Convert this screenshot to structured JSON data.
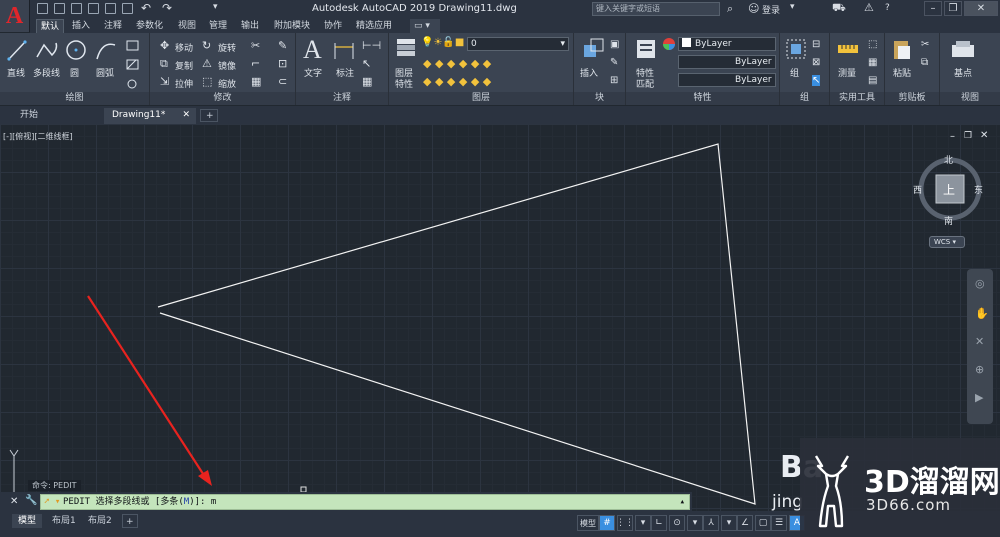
{
  "titlebar": {
    "logo_letter": "A",
    "title": "Autodesk AutoCAD 2019    Drawing11.dwg",
    "search_placeholder": "键入关键字或短语",
    "login": "登录",
    "help": "?"
  },
  "ribbon_tabs": [
    "默认",
    "插入",
    "注释",
    "参数化",
    "视图",
    "管理",
    "输出",
    "附加模块",
    "协作",
    "精选应用"
  ],
  "panels": {
    "draw": {
      "title": "绘图",
      "items": [
        "直线",
        "多段线",
        "圆",
        "圆弧"
      ]
    },
    "modify": {
      "title": "修改",
      "items": [
        "移动",
        "旋转",
        "复制",
        "镜像",
        "拉伸",
        "缩放"
      ]
    },
    "annotation": {
      "title": "注释",
      "items": [
        "文字",
        "标注"
      ]
    },
    "layers": {
      "title": "图层",
      "items": [
        "图层",
        "特性"
      ],
      "layer_value": "0"
    },
    "block": {
      "title": "块",
      "items": [
        "插入"
      ]
    },
    "properties": {
      "title": "特性",
      "items": [
        "特性",
        "匹配"
      ],
      "values": [
        "ByLayer",
        "ByLayer",
        "ByLayer"
      ]
    },
    "groups": {
      "title": "组",
      "items": [
        "组"
      ]
    },
    "utilities": {
      "title": "实用工具",
      "items": [
        "测量"
      ]
    },
    "clipboard": {
      "title": "剪贴板",
      "items": [
        "粘贴"
      ]
    },
    "view": {
      "title": "视图",
      "items": [
        "基点"
      ]
    }
  },
  "file_tabs": [
    "开始",
    "Drawing11*"
  ],
  "viewport_label": "[-][俯视][二维线框]",
  "viewcube": {
    "north": "北",
    "south": "南",
    "east": "东",
    "west": "西",
    "top": "上",
    "ucs": "WCS"
  },
  "command": {
    "history": "命令: PEDIT",
    "prefix": "PEDIT 选择多段线或 [多条(",
    "option_key": "M",
    "suffix": ")]: m"
  },
  "layout_tabs": [
    "模型",
    "布局1",
    "布局2"
  ],
  "status": {
    "model": "模型"
  },
  "watermark": {
    "main": "3D溜溜网",
    "sub": "3D66.com",
    "bai": "Ba",
    "jin": "jing"
  },
  "colors": {
    "accent_red": "#e0262b",
    "annotation_arrow": "#e8231f",
    "command_bg": "#c4e5bc",
    "canvas": "#212830"
  }
}
